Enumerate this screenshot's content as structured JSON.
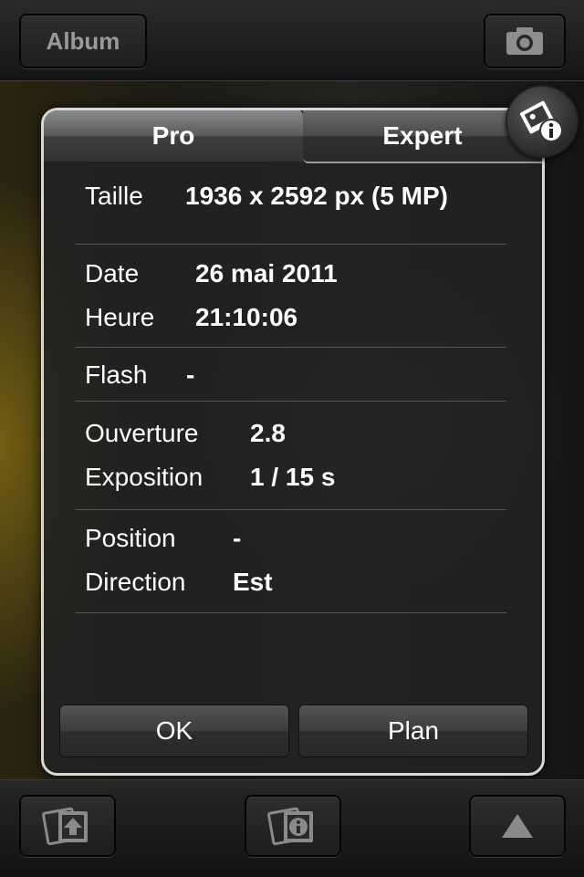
{
  "topbar": {
    "album_label": "Album",
    "camera_icon": "camera-icon"
  },
  "panel": {
    "tabs": [
      {
        "label": "Pro"
      },
      {
        "label": "Expert"
      }
    ],
    "rows": {
      "size": {
        "label": "Taille",
        "value": "1936 x 2592 px (5 MP)"
      },
      "date": {
        "label": "Date",
        "value": "26 mai 2011"
      },
      "time": {
        "label": "Heure",
        "value": "21:10:06"
      },
      "flash": {
        "label": "Flash",
        "value": "-"
      },
      "aperture": {
        "label": "Ouverture",
        "value": "2.8"
      },
      "exposure": {
        "label": "Exposition",
        "value": "1 / 15 s"
      },
      "position": {
        "label": "Position",
        "value": "-"
      },
      "direction": {
        "label": "Direction",
        "value": "Est"
      }
    },
    "buttons": {
      "ok": "OK",
      "map": "Plan"
    }
  },
  "bottombar": {
    "icons": [
      "share-photo-icon",
      "photo-info-icon",
      "triangle-up-icon"
    ]
  },
  "colors": {
    "panel_border": "#d8d8d8",
    "bar_button_text": "#9a9a9a"
  }
}
